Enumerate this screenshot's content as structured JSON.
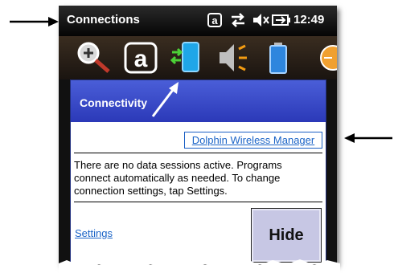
{
  "statusbar": {
    "title": "Connections",
    "time": "12:49",
    "icons": [
      "a-keyboard-icon",
      "data-transfer-icon",
      "speaker-muted-icon",
      "battery-charging-icon"
    ]
  },
  "tray": {
    "icons": [
      "zoom-icon",
      "a-keyboard-tray-icon",
      "connectivity-tray-icon",
      "volume-tray-icon",
      "battery-tray-icon",
      "clock-tray-icon"
    ]
  },
  "dialog": {
    "title": "Connectivity",
    "wireless_link": "Dolphin Wireless Manager",
    "info_line1": "There are no data sessions active. Programs",
    "info_line2": "connect automatically as needed. To change",
    "info_line3": "connection settings, tap Settings.",
    "settings_link": "Settings",
    "hide_button": "Hide"
  },
  "colors": {
    "header_blue": "#3645c4",
    "link_blue": "#1b64c7",
    "hide_button_bg": "#c7c7e4"
  }
}
